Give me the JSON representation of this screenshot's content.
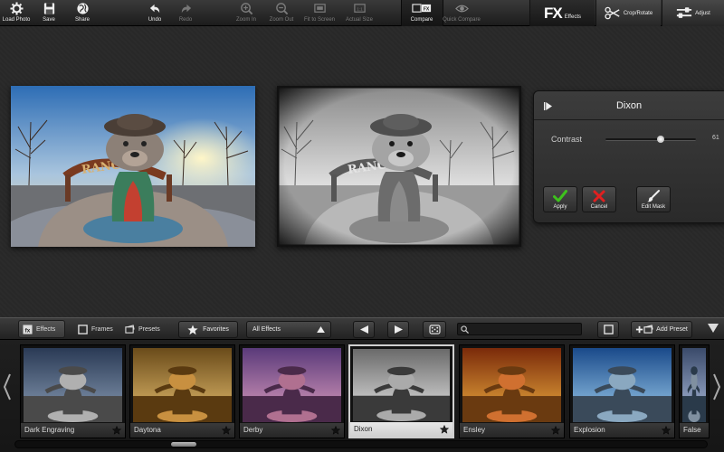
{
  "toolbar": {
    "load_photo": "Load Photo",
    "save": "Save",
    "share": "Share",
    "undo": "Undo",
    "redo": "Redo",
    "zoom_in": "Zoom In",
    "zoom_out": "Zoom Out",
    "fit_to_screen": "Fit to Screen",
    "actual_size": "Actual Size",
    "compare": "Compare",
    "quick_compare": "Quick Compare",
    "effects": "Effects",
    "crop_rotate": "Crop/Rotate",
    "adjust": "Adjust",
    "fx_logo": "FX",
    "compare_fx_icon_text": "FX"
  },
  "effect_panel": {
    "title": "Dixon",
    "contrast_label": "Contrast",
    "contrast_value": "61",
    "contrast_fraction": 0.61,
    "apply": "Apply",
    "cancel": "Cancel",
    "edit_mask": "Edit Mask"
  },
  "bottom_bar": {
    "tab_effects": "Effects",
    "tab_frames": "Frames",
    "tab_presets": "Presets",
    "favorites": "Favorites",
    "filter_selected": "All Effects",
    "search_placeholder": "",
    "add_preset": "Add Preset"
  },
  "strip": {
    "thumbs": [
      {
        "label": "Dark Engraving",
        "style": "engraving",
        "selected": false
      },
      {
        "label": "Daytona",
        "style": "daytona",
        "selected": false
      },
      {
        "label": "Derby",
        "style": "derby",
        "selected": false
      },
      {
        "label": "Dixon",
        "style": "dixon",
        "selected": true
      },
      {
        "label": "Ensley",
        "style": "ensley",
        "selected": false
      },
      {
        "label": "Explosion",
        "style": "explosion",
        "selected": false
      },
      {
        "label": "False",
        "style": "false",
        "selected": false
      }
    ]
  },
  "colors": {
    "apply_check": "#3ec11d",
    "cancel_x": "#e02020",
    "accent_white": "#ffffff"
  }
}
